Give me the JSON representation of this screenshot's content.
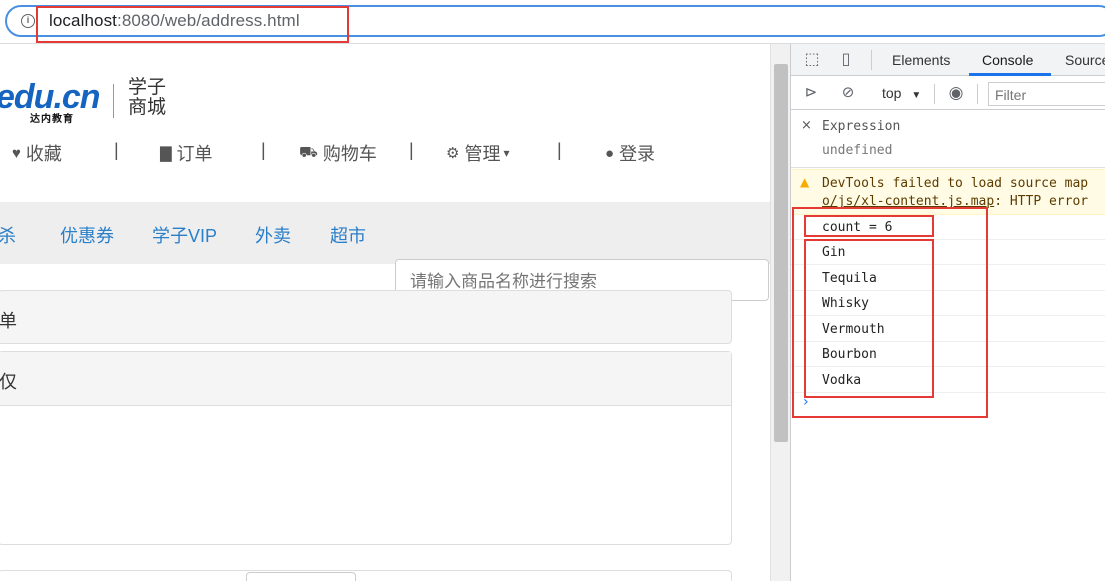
{
  "browser": {
    "url_host": "localhost",
    "url_rest": ":8080/web/address.html",
    "info_icon": "info-icon"
  },
  "page": {
    "logo_main": "edu.cn",
    "logo_sub": "达内教育",
    "logo_text_line1": "学子",
    "logo_text_line2": "商城",
    "topnav": [
      {
        "label": "收藏",
        "icon": "heart-icon"
      },
      {
        "label": "订单",
        "icon": "file-icon"
      },
      {
        "label": "购物车",
        "icon": "cart-icon"
      },
      {
        "label": "管理",
        "icon": "gear-icon",
        "caret": "▾"
      },
      {
        "label": "登录",
        "icon": "user-icon"
      }
    ],
    "separator": "|",
    "categories": [
      "秒杀",
      "优惠券",
      "学子VIP",
      "外卖",
      "超市"
    ],
    "category_first_visible": "杀",
    "search_placeholder": "请输入商品名称进行搜索",
    "panel1_title": "单",
    "panel2_title": "仅"
  },
  "devtools": {
    "tabs": [
      "Elements",
      "Console",
      "Source"
    ],
    "active_tab": "Console",
    "context": "top",
    "context_caret": "▼",
    "filter_placeholder": "Filter",
    "expression": {
      "close": "×",
      "label": "Expression",
      "value": "undefined"
    },
    "warning": {
      "line1": "DevTools failed to load source map",
      "line2_link": "o/js/xl-content.js.map",
      "line2_rest": ": HTTP error"
    },
    "logs": [
      "count = 6",
      "Gin",
      "Tequila",
      "Whisky",
      "Vermouth",
      "Bourbon",
      "Vodka"
    ],
    "prompt": "›"
  }
}
